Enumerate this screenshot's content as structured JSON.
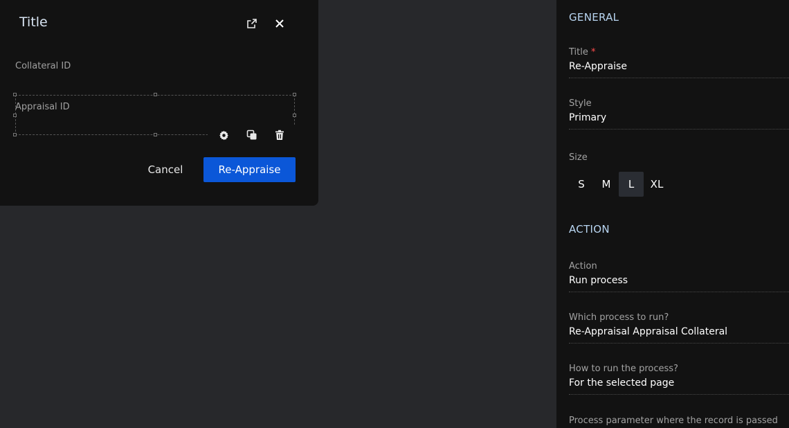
{
  "modal": {
    "title": "Title",
    "fields": {
      "collateral_id_label": "Collateral ID",
      "appraisal_id_label": "Appraisal ID"
    },
    "cancel_label": "Cancel",
    "submit_label": "Re-Appraise",
    "icons": [
      "open-external-icon",
      "close-icon",
      "settings-icon",
      "copy-icon",
      "delete-icon"
    ]
  },
  "panel": {
    "general": {
      "heading": "GENERAL",
      "title_label": "Title",
      "required_mark": "*",
      "title_value": "Re-Appraise",
      "style_label": "Style",
      "style_value": "Primary",
      "size_label": "Size",
      "sizes": [
        "S",
        "M",
        "L",
        "XL"
      ],
      "size_selected": "L"
    },
    "action": {
      "heading": "ACTION",
      "action_label": "Action",
      "action_value": "Run process",
      "process_label": "Which process to run?",
      "process_value": "Re-Appraisal Appraisal Collateral",
      "how_label": "How to run the process?",
      "how_value": "For the selected page",
      "param_label": "Process parameter where the record is passed"
    }
  },
  "colors": {
    "canvas_bg": "#27282b",
    "surface": "#121212",
    "primary": "#0b57d8",
    "heading_blue": "#b9d6f2",
    "required": "#ff4d4d"
  }
}
